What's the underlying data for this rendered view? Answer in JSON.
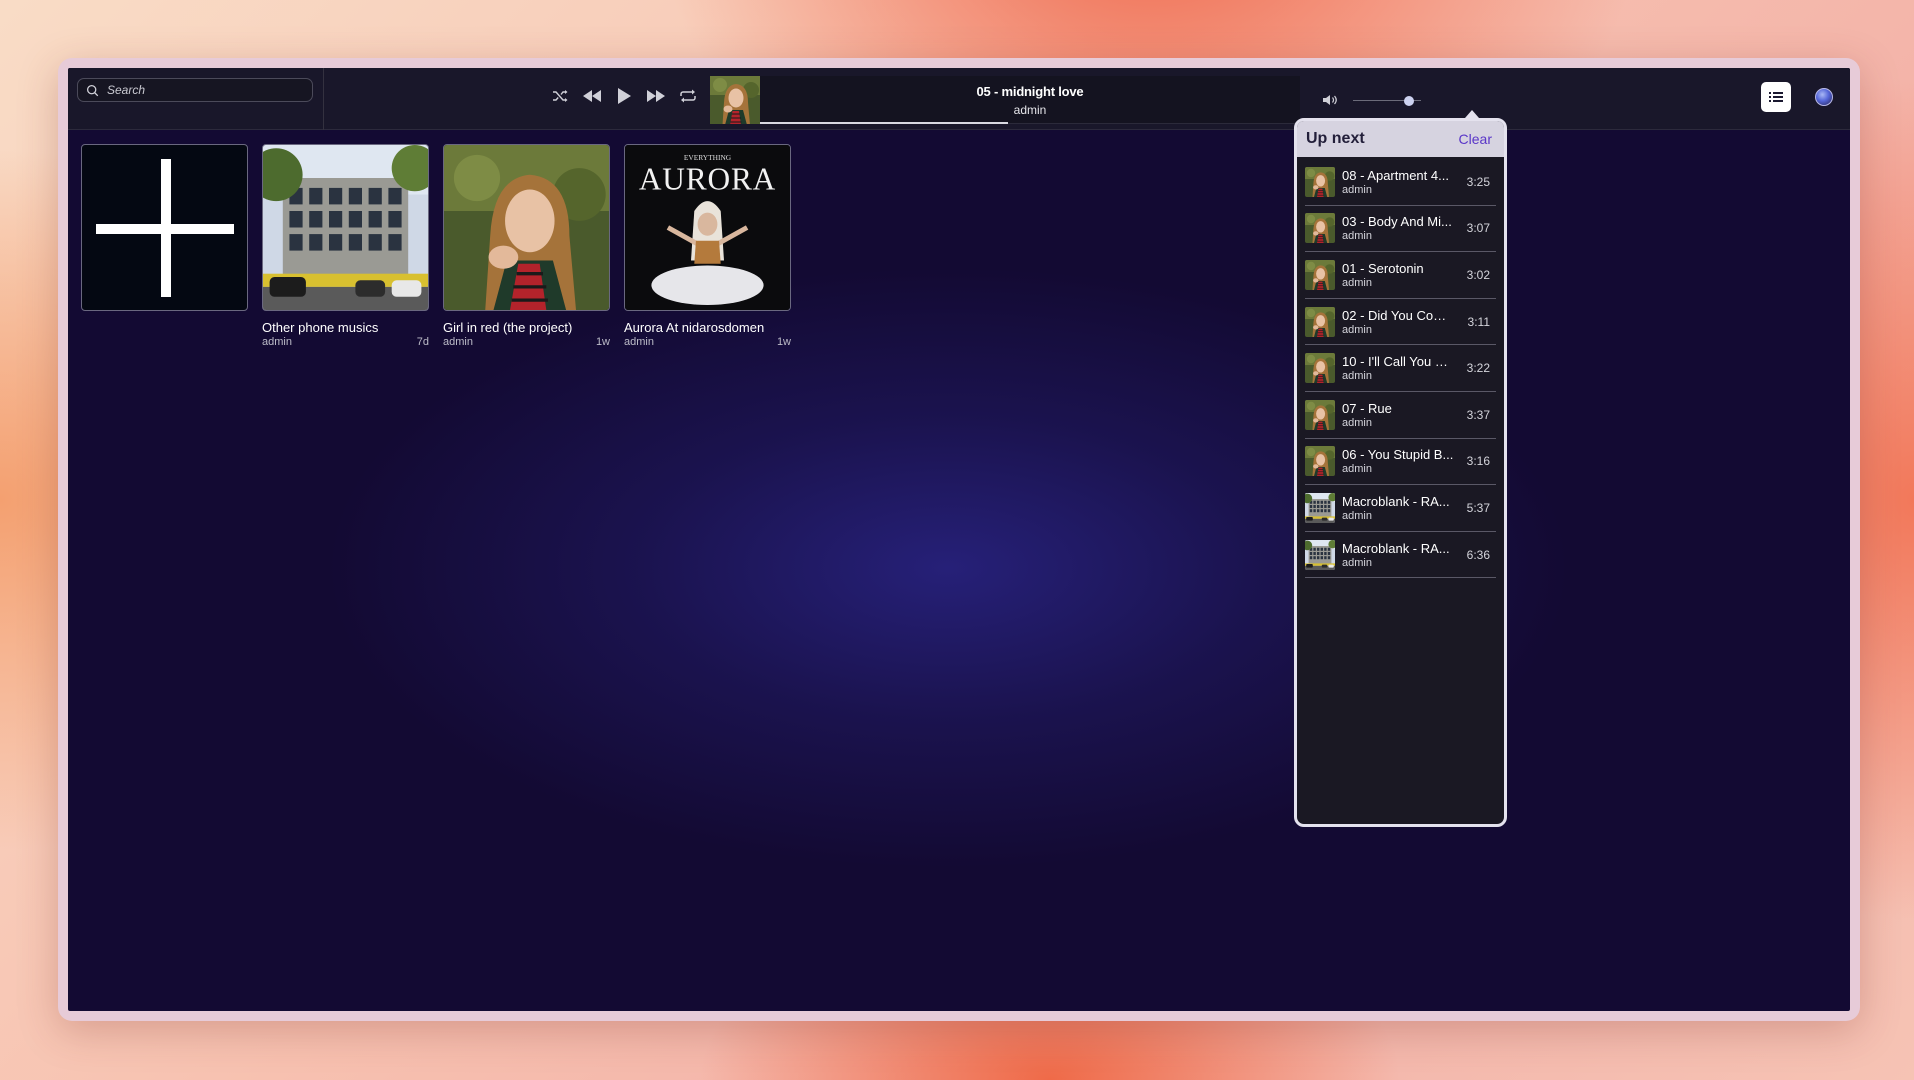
{
  "search": {
    "placeholder": "Search"
  },
  "player": {
    "title": "05 - midnight love",
    "artist": "admin",
    "progress": 0.46,
    "volume": 0.82
  },
  "library": {
    "add_label": "",
    "albums": [
      {
        "title": "Other phone musics",
        "owner": "admin",
        "age": "7d",
        "art": "building"
      },
      {
        "title": "Girl in red (the project)",
        "owner": "admin",
        "age": "1w",
        "art": "girl"
      },
      {
        "title": "Aurora At nidarosdomen",
        "owner": "admin",
        "age": "1w",
        "art": "aurora",
        "art_text": "AURORA",
        "art_subtext": "EVERYTHING"
      }
    ]
  },
  "upnext": {
    "title": "Up next",
    "clear_label": "Clear",
    "items": [
      {
        "title": "08 - Apartment 4...",
        "artist": "admin",
        "duration": "3:25",
        "art": "girl"
      },
      {
        "title": "03 - Body And Mi...",
        "artist": "admin",
        "duration": "3:07",
        "art": "girl"
      },
      {
        "title": "01 - Serotonin",
        "artist": "admin",
        "duration": "3:02",
        "art": "girl"
      },
      {
        "title": "02 - Did You Com...",
        "artist": "admin",
        "duration": "3:11",
        "art": "girl"
      },
      {
        "title": "10 - I'll Call You M...",
        "artist": "admin",
        "duration": "3:22",
        "art": "girl"
      },
      {
        "title": "07 - Rue",
        "artist": "admin",
        "duration": "3:37",
        "art": "girl"
      },
      {
        "title": "06 - You Stupid B...",
        "artist": "admin",
        "duration": "3:16",
        "art": "girl"
      },
      {
        "title": "Macroblank - RA...",
        "artist": "admin",
        "duration": "5:37",
        "art": "building"
      },
      {
        "title": "Macroblank - RA...",
        "artist": "admin",
        "duration": "6:36",
        "art": "building"
      }
    ]
  }
}
